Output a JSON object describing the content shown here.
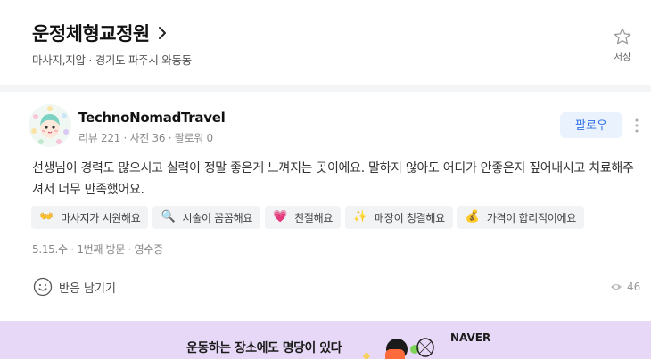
{
  "header": {
    "place_name": "운정체형교정원",
    "subtitle": "마사지,지압 · 경기도 파주시 와동동",
    "save_label": "저장"
  },
  "review": {
    "user_name": "TechnoNomadTravel",
    "user_stats": "리뷰 221 · 사진 36 · 팔로워 0",
    "follow_label": "팔로우",
    "text": "선생님이 경력도 많으시고 실력이 정말 좋은게 느껴지는 곳이에요. 말하지 않아도 어디가 안좋은지 짚어내시고 치료해주셔서 너무 만족했어요.",
    "tags": [
      {
        "icon": "hands-icon",
        "emoji": "👐",
        "label": "마사지가 시원해요"
      },
      {
        "icon": "magnifier-icon",
        "emoji": "🔍",
        "label": "시술이 꼼꼼해요"
      },
      {
        "icon": "heart-icon",
        "emoji": "💗",
        "label": "친절해요"
      },
      {
        "icon": "sparkle-icon",
        "emoji": "✨",
        "label": "매장이 청결해요"
      },
      {
        "icon": "coins-icon",
        "emoji": "💰",
        "label": "가격이 합리적이에요"
      }
    ],
    "meta": "5.15.수 · 1번째 방문 · 영수증",
    "react_label": "반응 남기기",
    "views": "46"
  },
  "banner": {
    "text": "운동하는 장소에도 명당이 있다",
    "brand": "NAVER"
  }
}
